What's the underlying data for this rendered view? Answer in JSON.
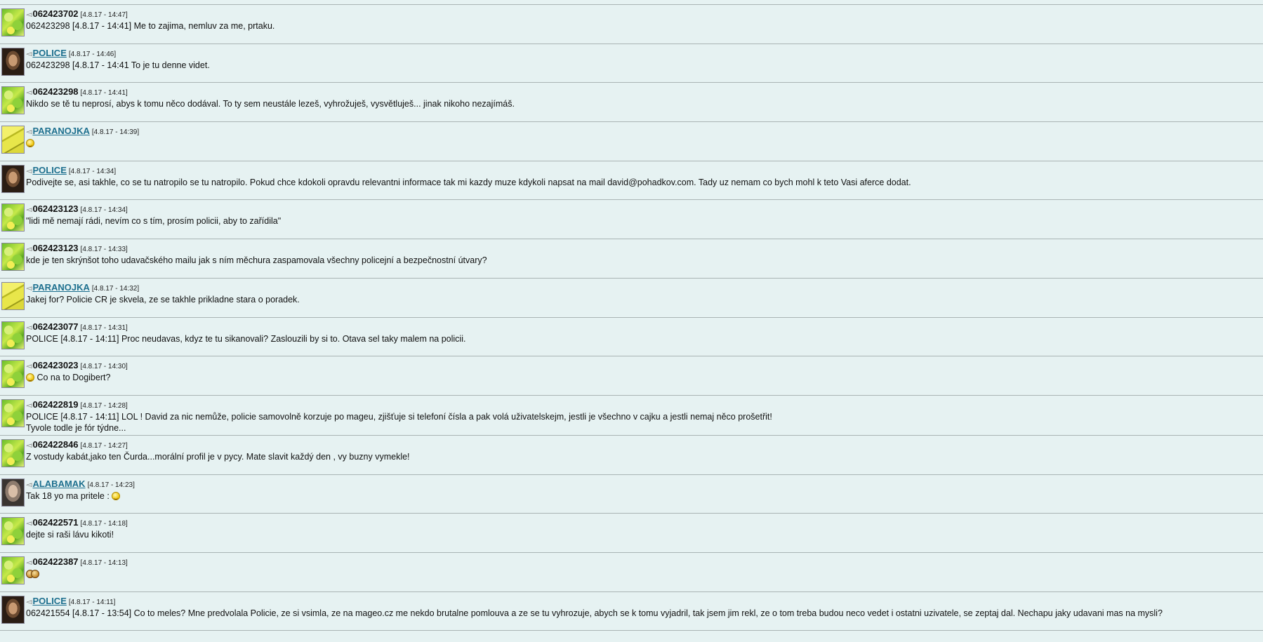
{
  "posts": [
    {
      "avatar": "lizard",
      "nick": "062423702",
      "link": false,
      "time": "[4.8.17 - 14:47]",
      "lines": [
        "062423298 [4.8.17 - 14:41] Me to zajima, nemluv za me, prtaku."
      ]
    },
    {
      "avatar": "police",
      "nick": "POLICE",
      "link": true,
      "time": "[4.8.17 - 14:46]",
      "lines": [
        "062423298 [4.8.17 - 14:41 To je tu denne videt."
      ]
    },
    {
      "avatar": "lizard",
      "nick": "062423298",
      "link": false,
      "time": "[4.8.17 - 14:41]",
      "lines": [
        "Nikdo se tě tu neprosí, abys k tomu něco dodával. To ty sem neustále lezeš, vyhrožuješ, vysvětluješ... jinak nikoho nezajímáš."
      ]
    },
    {
      "avatar": "paranojka",
      "nick": "PARANOJKA",
      "link": true,
      "time": "[4.8.17 - 14:39]",
      "lines": [
        ""
      ],
      "emote": "smile"
    },
    {
      "avatar": "police",
      "nick": "POLICE",
      "link": true,
      "time": "[4.8.17 - 14:34]",
      "lines": [
        "Podivejte se, asi takhle, co se tu natropilo se tu natropilo. Pokud chce kdokoli opravdu relevantni informace tak mi kazdy muze kdykoli napsat na mail david@pohadkov.com. Tady uz nemam co bych mohl k teto Vasi aferce dodat."
      ]
    },
    {
      "avatar": "lizard",
      "nick": "062423123",
      "link": false,
      "time": "[4.8.17 - 14:34]",
      "lines": [
        "\"lidi mě nemají rádi, nevím co s tím, prosím policii, aby to zařídila\""
      ]
    },
    {
      "avatar": "lizard",
      "nick": "062423123",
      "link": false,
      "time": "[4.8.17 - 14:33]",
      "lines": [
        "kde je ten skrýnšot toho udavačského mailu jak s ním měchura zaspamovala všechny policejní a bezpečnostní útvary?"
      ]
    },
    {
      "avatar": "paranojka",
      "nick": "PARANOJKA",
      "link": true,
      "time": "[4.8.17 - 14:32]",
      "lines": [
        "Jakej for? Policie CR je skvela, ze se takhle prikladne stara o poradek."
      ]
    },
    {
      "avatar": "lizard",
      "nick": "062423077",
      "link": false,
      "time": "[4.8.17 - 14:31]",
      "lines": [
        "POLICE [4.8.17 - 14:11] Proc neudavas, kdyz te tu sikanovali? Zaslouzili by si to. Otava sel taky malem na policii."
      ]
    },
    {
      "avatar": "lizard",
      "nick": "062423023",
      "link": false,
      "time": "[4.8.17 - 14:30]",
      "lines": [
        "Co na to Dogibert?"
      ],
      "emote": "smile-lead"
    },
    {
      "avatar": "lizard",
      "nick": "062422819",
      "link": false,
      "time": "[4.8.17 - 14:28]",
      "lines": [
        "POLICE [4.8.17 - 14:11] LOL ! David za nic nemůže, policie samovolně korzuje po mageu, zjišťuje si telefoní čísla a pak volá uživatelskejm, jestli je všechno v cajku a jestli nemaj něco prošetřit!",
        "Tyvole todle je fór týdne..."
      ]
    },
    {
      "avatar": "lizard",
      "nick": "062422846",
      "link": false,
      "time": "[4.8.17 - 14:27]",
      "lines": [
        "Z vostudy kabát,jako ten Čurda...morální profil je v pycy. Mate slavit každý den , vy buzny vymekle!"
      ]
    },
    {
      "avatar": "alabamak",
      "nick": "ALABAMAK",
      "link": true,
      "time": "[4.8.17 - 14:23]",
      "lines": [
        "Tak 18 yo ma pritele : "
      ],
      "emote": "smile-trail"
    },
    {
      "avatar": "lizard",
      "nick": "062422571",
      "link": false,
      "time": "[4.8.17 - 14:18]",
      "lines": [
        "dejte si raši lávu kikoti!"
      ]
    },
    {
      "avatar": "lizard",
      "nick": "062422387",
      "link": false,
      "time": "[4.8.17 - 14:13]",
      "lines": [
        ""
      ],
      "emote": "pair"
    },
    {
      "avatar": "police",
      "nick": "POLICE",
      "link": true,
      "time": "[4.8.17 - 14:11]",
      "lines": [
        "062421554 [4.8.17 - 13:54] Co to meles? Mne predvolala Policie, ze si vsimla, ze na mageo.cz me nekdo brutalne pomlouva a ze se tu vyhrozuje, abych se k tomu vyjadril, tak jsem jim rekl, ze o tom treba budou neco vedet i ostatni uzivatele, se zeptaj dal. Nechapu jaky udavani mas na mysli?"
      ]
    }
  ]
}
